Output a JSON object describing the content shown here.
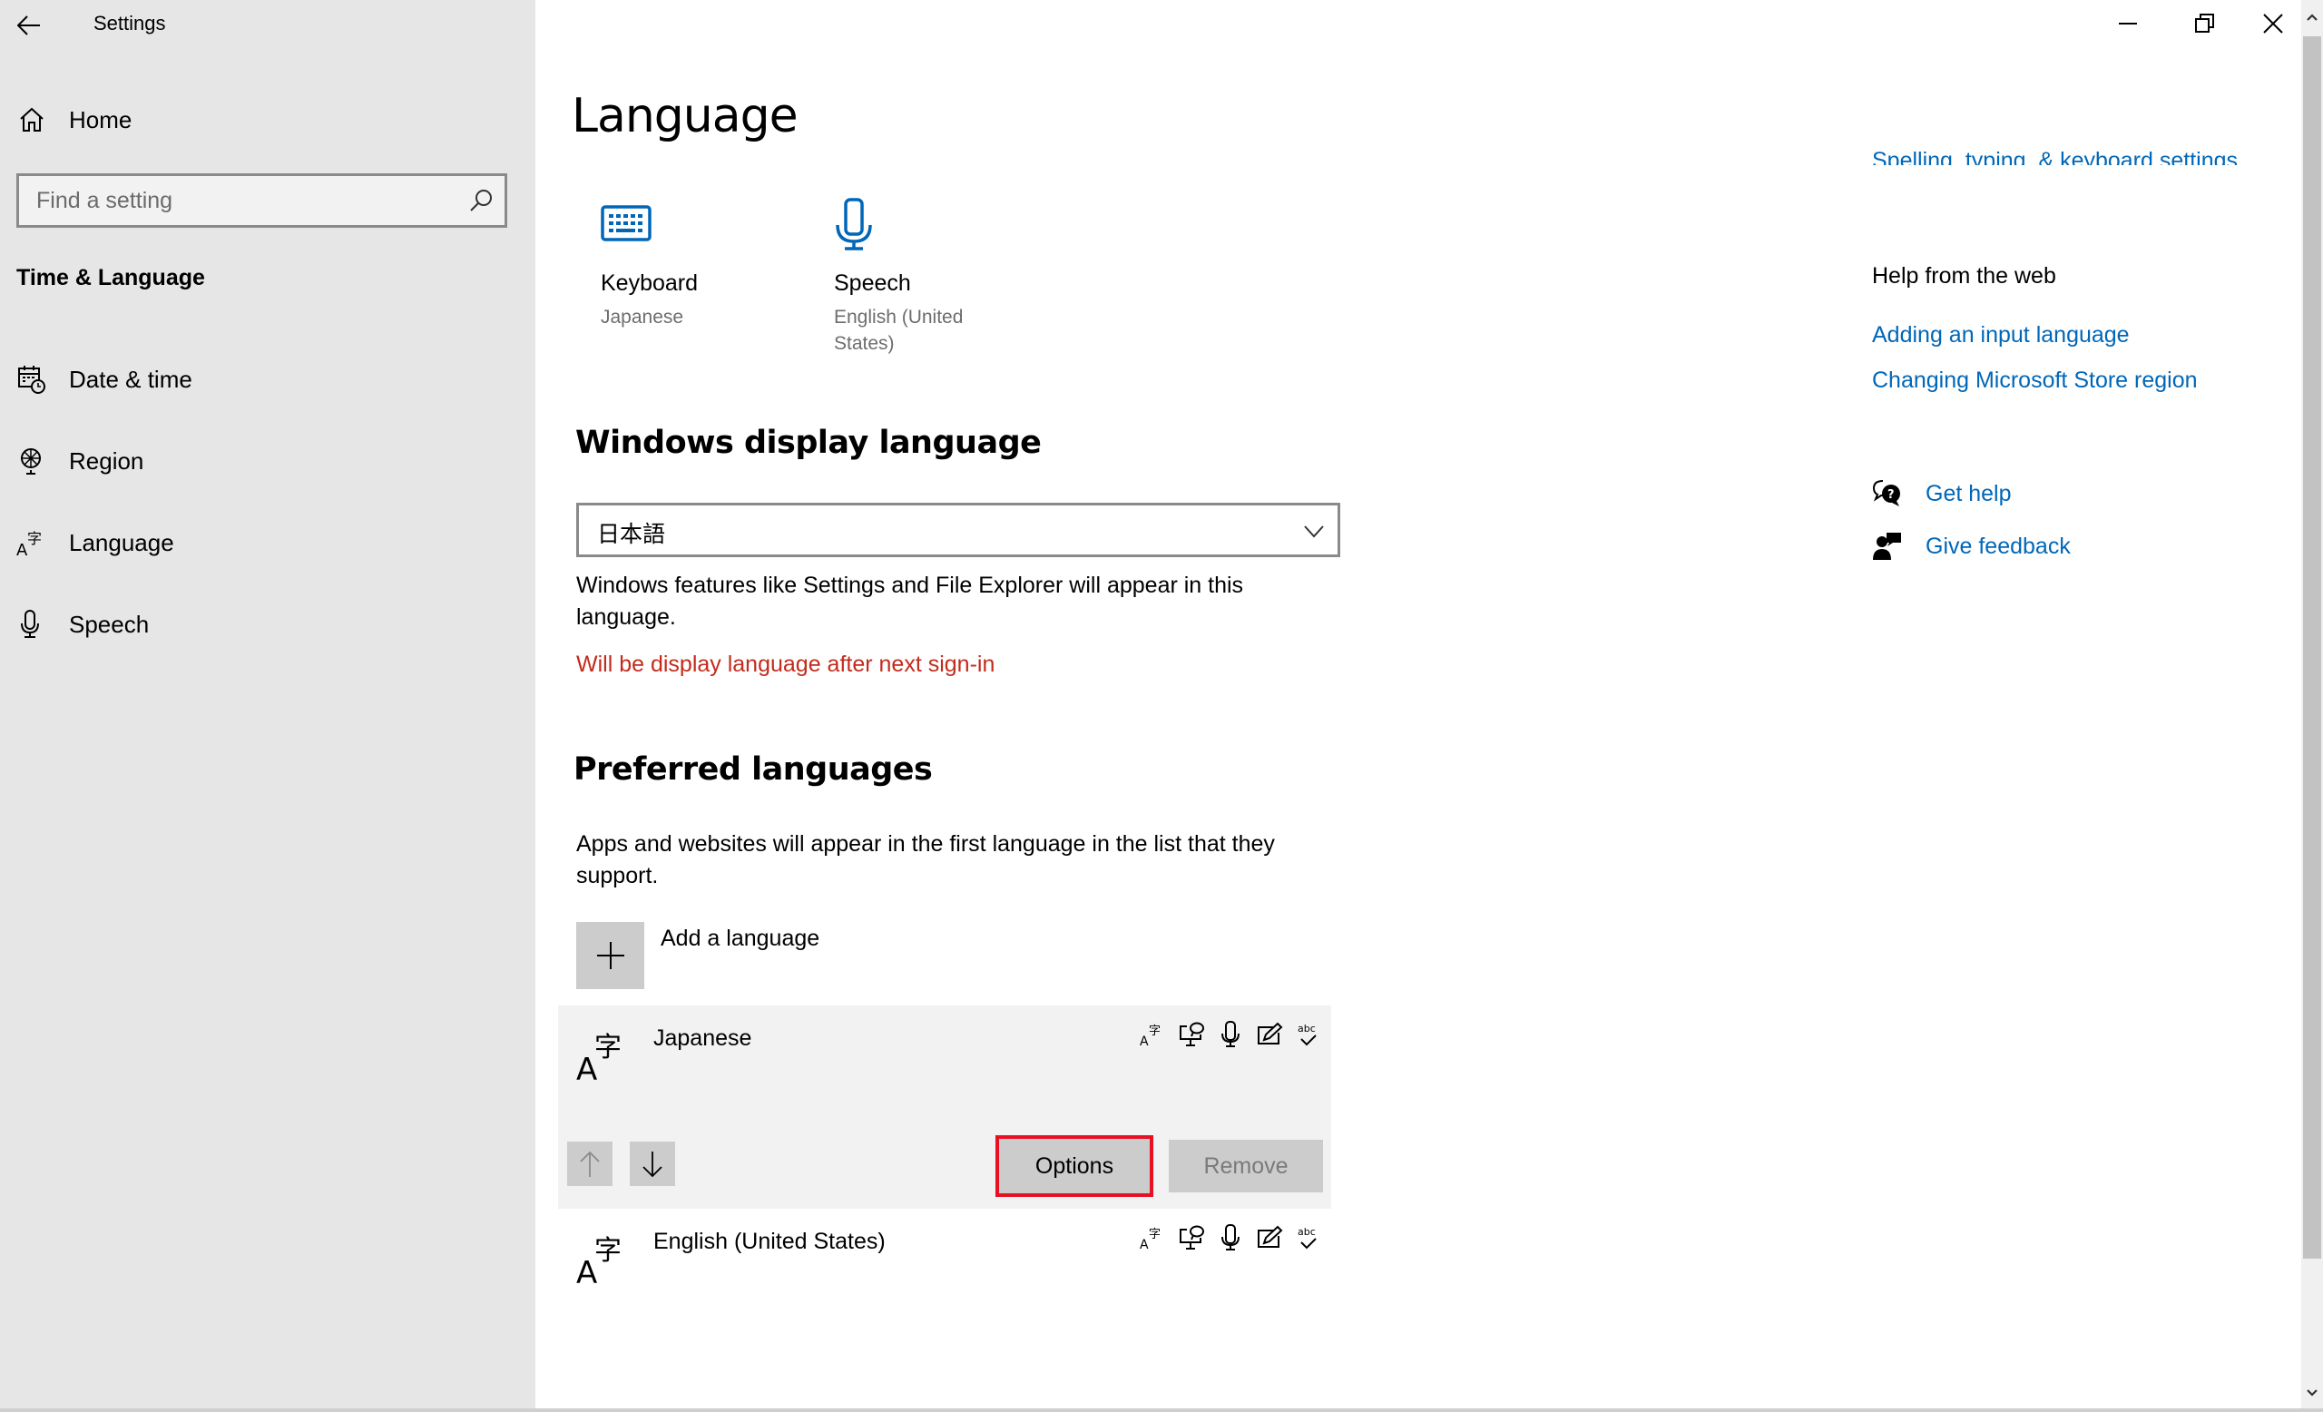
{
  "window": {
    "title": "Settings",
    "controls": {
      "minimize": "minimize-icon",
      "restore": "restore-icon",
      "close": "close-icon"
    }
  },
  "sidebar": {
    "home_label": "Home",
    "search": {
      "placeholder": "Find a setting",
      "value": ""
    },
    "section_title": "Time & Language",
    "items": [
      {
        "label": "Date & time",
        "icon": "calendar-clock-icon"
      },
      {
        "label": "Region",
        "icon": "globe-icon"
      },
      {
        "label": "Language",
        "icon": "language-icon",
        "selected": true
      },
      {
        "label": "Speech",
        "icon": "microphone-icon"
      }
    ]
  },
  "main": {
    "page_title": "Language",
    "tiles": [
      {
        "name": "Keyboard",
        "sub": "Japanese",
        "icon": "keyboard-icon"
      },
      {
        "name": "Speech",
        "sub": "English (United States)",
        "icon": "microphone-icon"
      }
    ],
    "display_language": {
      "heading": "Windows display language",
      "selected": "日本語",
      "description": "Windows features like Settings and File Explorer will appear in this language.",
      "warning": "Will be display language after next sign-in"
    },
    "preferred": {
      "heading": "Preferred languages",
      "description": "Apps and websites will appear in the first language in the list that they support.",
      "add_label": "Add a language",
      "languages": [
        {
          "name": "Japanese",
          "selected": true,
          "features": [
            "display-language-icon",
            "text-to-speech-icon",
            "speech-recognition-icon",
            "handwriting-icon",
            "spell-check-icon"
          ]
        },
        {
          "name": "English (United States)",
          "selected": false,
          "features": [
            "display-language-icon",
            "text-to-speech-icon",
            "speech-recognition-icon",
            "handwriting-icon",
            "spell-check-icon"
          ]
        }
      ],
      "options_label": "Options",
      "remove_label": "Remove"
    }
  },
  "right": {
    "related_link": "Spelling, typing, & keyboard settings",
    "help_heading": "Help from the web",
    "help_links": [
      "Adding an input language",
      "Changing Microsoft Store region"
    ],
    "get_help": "Get help",
    "give_feedback": "Give feedback"
  },
  "colors": {
    "accent": "#0067b8",
    "warning": "#c42b1c",
    "highlight_border": "#e81123",
    "sidebar_bg": "#e6e6e6"
  }
}
